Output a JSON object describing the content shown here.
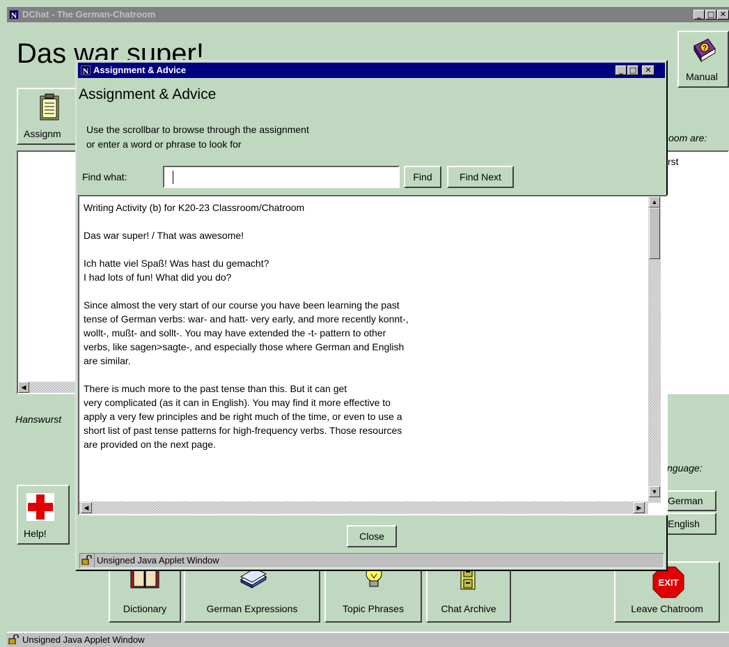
{
  "main_window": {
    "title": "DChat - The German-Chatroom",
    "heading": "Das war super!",
    "assignment_button": "Assignm",
    "manual_button": "Manual",
    "room_label": "oom are:",
    "user_list": [
      "rst"
    ],
    "current_user": "Hanswurst",
    "language_label": "nguage:",
    "german_button": "German",
    "english_button": "English",
    "help_button": "Help!",
    "toolbar": {
      "dictionary": "Dictionary",
      "german_expressions": "German Expressions",
      "topic_phrases": "Topic Phrases",
      "chat_archive": "Chat Archive",
      "leave_chatroom": "Leave Chatroom",
      "exit_icon_text": "EXIT"
    },
    "status": "Unsigned Java Applet Window"
  },
  "dialog": {
    "title": "Assignment & Advice",
    "heading": "Assignment & Advice",
    "instructions": "Use the scrollbar to browse through the assignment\nor enter a word or phrase to look for",
    "find_label": "Find what:",
    "find_value": "",
    "find_button": "Find",
    "find_next_button": "Find Next",
    "content": "Writing Activity (b) for K20-23 Classroom/Chatroom\n\nDas war super! / That was awesome!\n\nIch hatte viel Spaß! Was hast du gemacht?\nI had lots of fun! What did you do?\n\nSince almost the very start of our course you have been learning the past\ntense of German verbs: war- and hatt- very early, and more recently konnt-,\nwollt-, mußt- and sollt-. You may have extended the -t- pattern to other\nverbs, like sagen>sagte-, and especially those where German and English\nare similar.\n\nThere is much more to the past tense than this. But it can get\nvery complicated (as it can in English). You may find it more effective to\napply a very few principles and be right much of the time, or even to use a\nshort list of past tense patterns for high-frequency verbs. Those resources\nare provided on the next page.",
    "close_button": "Close",
    "status": "Unsigned Java Applet Window"
  },
  "colors": {
    "background": "#c0d8c0",
    "active_title": "#000080",
    "inactive_title": "#808080"
  }
}
